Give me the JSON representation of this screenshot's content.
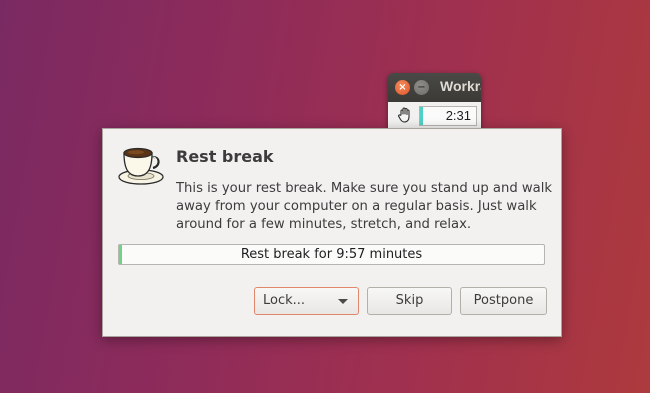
{
  "mini_window": {
    "title": "Workrave",
    "close_glyph": "×",
    "min_glyph": "−",
    "timer": "2:31",
    "timer_progress": 0.05,
    "icon": "hand-icon"
  },
  "dialog": {
    "title": "Rest break",
    "message": "This is your rest break. Make sure you stand up and walk away from your computer on a regular basis. Just walk around for a few minutes, stretch, and relax.",
    "progress_label": "Rest break for 9:57 minutes",
    "progress_value": 0.005,
    "icon": "coffee-cup-icon",
    "buttons": {
      "lock": "Lock...",
      "skip": "Skip",
      "postpone": "Postpone"
    }
  },
  "colors": {
    "accent_orange": "#e0866a",
    "mini_bar_fill": "#4fd0c6",
    "progress_fill": "#6fd486"
  }
}
